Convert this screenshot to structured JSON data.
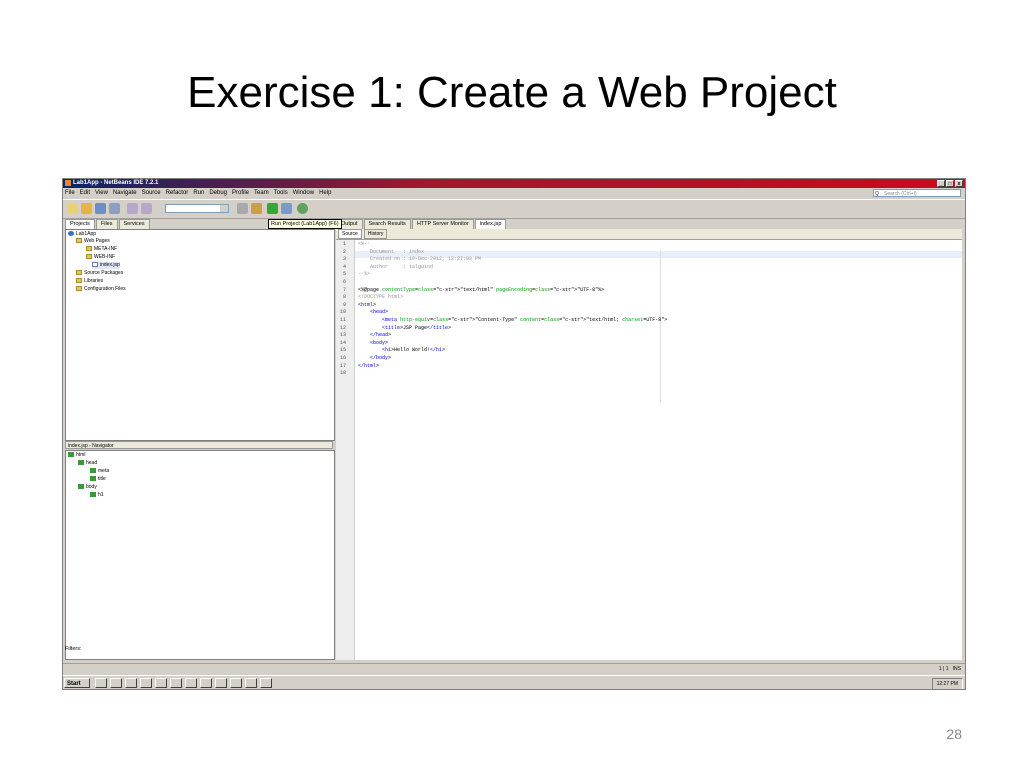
{
  "slide": {
    "title": "Exercise 1: Create a Web Project",
    "number": "28"
  },
  "window": {
    "title": "Lab1App - NetBeans IDE 7.2.1",
    "controls": [
      "_",
      "□",
      "x"
    ]
  },
  "menu": [
    "File",
    "Edit",
    "View",
    "Navigate",
    "Source",
    "Refactor",
    "Run",
    "Debug",
    "Profile",
    "Team",
    "Tools",
    "Window",
    "Help"
  ],
  "search": {
    "placeholder": "Search (Ctrl+I)"
  },
  "tooltip": "Run Project (Lab1App) (F6)",
  "left_tabs": [
    "Projects",
    "Files",
    "Services"
  ],
  "project_tree": [
    "Lab1App",
    "Web Pages",
    "META-INF",
    "WEB-INF",
    "index.jsp",
    "Source Packages",
    "Libraries",
    "Configuration Files"
  ],
  "navigator": {
    "title": "index.jsp - Navigator",
    "tree": [
      "html",
      "head",
      "meta",
      "title",
      "body",
      "h1"
    ]
  },
  "filters_label": "Filters:",
  "editor_tabs": [
    "Output",
    "Search Results",
    "HTTP Server Monitor",
    "index.jsp"
  ],
  "editor_subtabs": [
    "Source",
    "History"
  ],
  "code_lines": [
    {
      "n": "1",
      "t": "<%--"
    },
    {
      "n": "2",
      "t": "    Document   : index"
    },
    {
      "n": "3",
      "t": "    Created on : 19-Dec-2012, 12:27:03 PM"
    },
    {
      "n": "4",
      "t": "    Author     : talguind"
    },
    {
      "n": "5",
      "t": "--%>"
    },
    {
      "n": "6",
      "t": ""
    },
    {
      "n": "7",
      "t": "<%@page contentType=\"text/html\" pageEncoding=\"UTF-8\"%>"
    },
    {
      "n": "8",
      "t": "<!DOCTYPE html>"
    },
    {
      "n": "9",
      "t": "<html>"
    },
    {
      "n": "10",
      "t": "    <head>"
    },
    {
      "n": "11",
      "t": "        <meta http-equiv=\"Content-Type\" content=\"text/html; charset=UTF-8\">"
    },
    {
      "n": "12",
      "t": "        <title>JSP Page</title>"
    },
    {
      "n": "13",
      "t": "    </head>"
    },
    {
      "n": "14",
      "t": "    <body>"
    },
    {
      "n": "15",
      "t": "        <h1>Hello World!</h1>"
    },
    {
      "n": "16",
      "t": "    </body>"
    },
    {
      "n": "17",
      "t": "</html>"
    },
    {
      "n": "18",
      "t": ""
    }
  ],
  "status": {
    "position": "1 | 1",
    "mode": "INS"
  },
  "taskbar": {
    "start": "Start",
    "clock": "12:27 PM"
  }
}
